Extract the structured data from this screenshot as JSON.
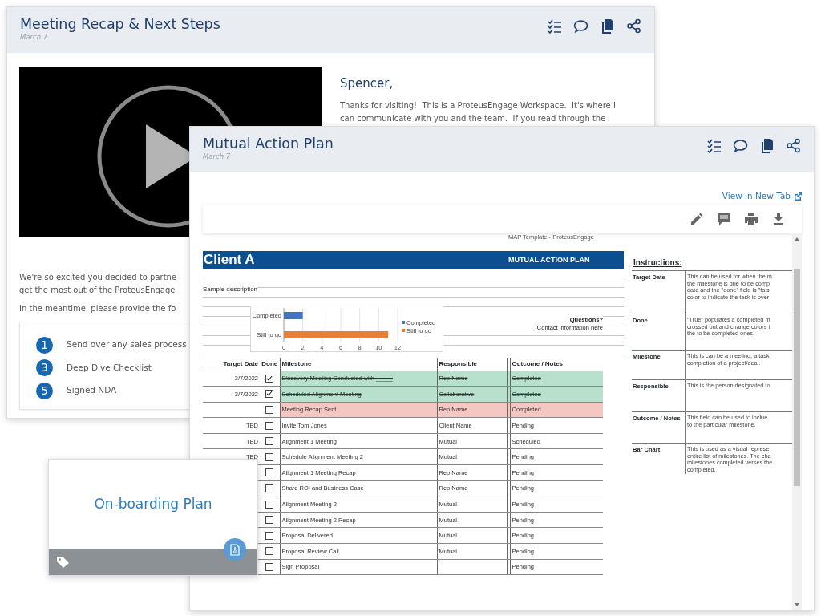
{
  "recap_card": {
    "title": "Meeting Recap & Next Steps",
    "date": "March 7",
    "greeting": "Spencer,",
    "message_lines": [
      "Thanks for visiting!  This is a ProteusEngage Workspace.  It's where I",
      "can communicate with you and the team.  If you read through the"
    ],
    "intro_lines": [
      "We're so excited you decided to partne",
      "get the most out of the ProteusEngage"
    ],
    "request_line": "In the meantime, please provide the fo",
    "steps": [
      {
        "number": "1",
        "label": "Send over any sales process"
      },
      {
        "number": "3",
        "label": "Deep Dive Checklist"
      },
      {
        "number": "5",
        "label": "Signed NDA"
      }
    ]
  },
  "plan_card": {
    "title": "Mutual Action Plan",
    "date": "March 7",
    "view_link": "View in New Tab",
    "sheet": {
      "template_caption": "MAP Template - ProteusEngage",
      "client": "Client A",
      "plan_label": "MUTUAL ACTION PLAN",
      "description": "Sample description",
      "questions": "Questions?",
      "contact": "Contact information here",
      "chart_data": {
        "type": "bar",
        "orientation": "horizontal",
        "categories": [
          "Completed",
          "Still to go"
        ],
        "series": [
          {
            "name": "Completed",
            "color": "#4472c4",
            "values": [
              2,
              null
            ]
          },
          {
            "name": "Still to go",
            "color": "#ed7d31",
            "values": [
              null,
              11
            ]
          }
        ],
        "xlim": [
          0,
          12
        ],
        "xticks": [
          0,
          2,
          4,
          6,
          8,
          10,
          12
        ],
        "grid": true,
        "legend": true
      },
      "columns": [
        "Target Date",
        "Done",
        "Milestone",
        "Responsible",
        "Outcome / Notes"
      ],
      "rows": [
        {
          "target_date": "3/7/2022",
          "done": true,
          "overdue": false,
          "milestone": "Discovery Meeting Conducted with _____",
          "responsible": "Rep Name",
          "outcome": "Completed"
        },
        {
          "target_date": "3/7/2022",
          "done": true,
          "overdue": false,
          "milestone": "Scheduled Alignment Meeting",
          "responsible": "Collaborative",
          "outcome": "Completed"
        },
        {
          "done": false,
          "overdue": true,
          "milestone": "Meeting Recap Sent",
          "responsible": "Rep Name",
          "outcome": "Completed"
        },
        {
          "target_date": "TBD",
          "done": false,
          "overdue": false,
          "milestone": "Invite Tom Jones",
          "responsible": "Client Name",
          "outcome": "Pending"
        },
        {
          "target_date": "TBD",
          "done": false,
          "overdue": false,
          "milestone": "Alignment 1 Meeting",
          "responsible": "Mutual",
          "outcome": "Scheduled"
        },
        {
          "target_date": "TBD",
          "done": false,
          "overdue": false,
          "milestone": "Schedule Alignment Meeting 2",
          "responsible": "Mutual",
          "outcome": "Pending"
        },
        {
          "done": false,
          "overdue": false,
          "milestone": "Alignment 1 Meeting Recap",
          "responsible": "Rep Name",
          "outcome": "Pending"
        },
        {
          "done": false,
          "overdue": false,
          "milestone": "Share ROI and Business Case",
          "responsible": "Rep Name",
          "outcome": "Pending"
        },
        {
          "done": false,
          "overdue": false,
          "milestone": "Alignment Meeting 2",
          "responsible": "Mutual",
          "outcome": "Pending"
        },
        {
          "done": false,
          "overdue": false,
          "milestone": "Alignment Meeting 2 Recap",
          "responsible": "Mutual",
          "outcome": "Pending"
        },
        {
          "done": false,
          "overdue": false,
          "milestone": "Proposal Delivered",
          "responsible": "Mutual",
          "outcome": "Pending"
        },
        {
          "done": false,
          "overdue": false,
          "milestone": "Proposal Review Call",
          "responsible": "Mutual",
          "outcome": "Pending"
        },
        {
          "done": false,
          "overdue": false,
          "milestone": "Sign Proposal",
          "outcome": "Pending"
        }
      ],
      "instructions": {
        "heading": "Instructions:",
        "items": [
          {
            "label": "Target Date",
            "lines": [
              "This can be used for when the m",
              "the milestone is due to be comp",
              "date and the \"done\" field is \"fals",
              "color to indicate the task is over"
            ]
          },
          {
            "label": "Done",
            "lines": [
              "\"True\" populates a completed m",
              "crossed out and change colors t",
              "the to be completed ones."
            ]
          },
          {
            "label": "Milestone",
            "lines": [
              "This is can be a meeting, a task,",
              "completion of a project/deal."
            ]
          },
          {
            "label": "Responsible",
            "lines": [
              "This is the person designated to"
            ]
          },
          {
            "label": "Outcome / Notes",
            "lines": [
              "This field can be used to inclue",
              "to the particular milestone."
            ]
          },
          {
            "label": "Bar Chart",
            "lines": [
              "This is used as a visual represe",
              "entire list of milestones. The cha",
              "milestones completed verses the",
              "completed."
            ]
          }
        ]
      }
    }
  },
  "onboarding_card": {
    "title": "On-boarding Plan"
  }
}
